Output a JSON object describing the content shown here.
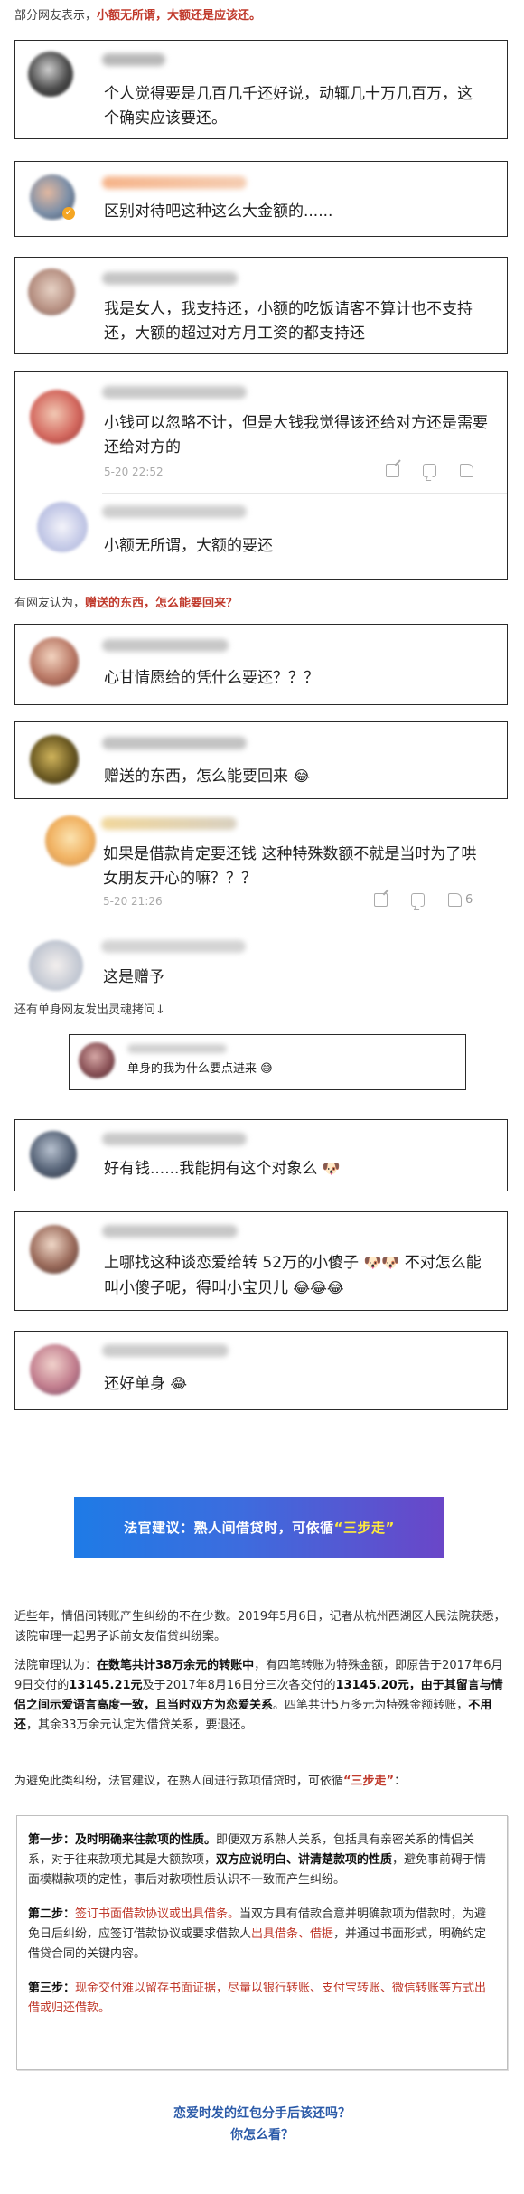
{
  "sections": {
    "s1_prefix": "部分网友表示，",
    "s1_highlight": "小额无所谓，大额还是应该还。",
    "s2_prefix": "有网友认为，",
    "s2_highlight": "赠送的东西，怎么能要回来？",
    "s3_text": "还有单身网友发出灵魂拷问↓"
  },
  "comments": {
    "c1": "个人觉得要是几百几千还好说，动辄几十万几百万，这个确实应该要还。",
    "c2": "区别对待吧这种这么大金额的......",
    "c3": "我是女人，我支持还，小额的吃饭请客不算计也不支持还，大额的超过对方月工资的都支持还",
    "c4": "小钱可以忽略不计，但是大钱我觉得该还给对方还是需要还给对方的",
    "c4_time": "5-20 22:52",
    "c5": "小额无所谓，大额的要还",
    "c6": "心甘情愿给的凭什么要还？？？",
    "c7": "赠送的东西，怎么能要回来",
    "c8": "如果是借款肯定要还钱 这种特殊数额不就是当时为了哄女朋友开心的嘛？？？",
    "c8_time": "5-20 21:26",
    "c8_likes": "6",
    "c9": "这是赠予",
    "c10": "单身的我为什么要点进来",
    "c11": "好有钱......我能拥有这个对象么",
    "c12": "上哪找这种谈恋爱给转 52万的小傻子",
    "c12b": "不对怎么能叫小傻子呢，得叫小宝贝儿",
    "c13": "还好单身"
  },
  "banner": {
    "prefix": "法官建议：熟人间借贷时，可依循",
    "highlight": "“三步走”"
  },
  "article": {
    "p1": "近些年，情侣间转账产生纠纷的不在少数。2019年5月6日，记者从杭州西湖区人民法院获悉，该院审理一起男子诉前女友借贷纠纷案。",
    "p2_a": "法院审理认为：",
    "p2_b": "在数笔共计38万余元的转账中",
    "p2_c": "，有四笔转账为特殊金额，即原告于2017年6月9日交付的",
    "p2_d": "13145.21元",
    "p2_e": "及于2017年8月16日分三次各交付的",
    "p2_f": "13145.20元",
    "p2_g": "，由于其留言与情侣之间示爱语言高度一致，且当时双方为恋爱关系",
    "p2_h": "。四笔共计5万多元为特殊金额转账，",
    "p2_i": "不用还",
    "p2_j": "，其余33万余元认定为借贷关系，要退还。",
    "p3_a": "为避免此类纠纷，法官建议，在熟人间进行款项借贷时，可依循",
    "p3_b": "“三步走”",
    "p3_c": "："
  },
  "steps": {
    "s1_label": "第一步：",
    "s1_title": "及时明确来往款项的性质。",
    "s1_a": "即便双方系熟人关系，包括具有亲密关系的情侣关系，对于往来款项尤其是大额款项，",
    "s1_b": "双方应说明白、讲清楚款项的性质",
    "s1_c": "，避免事前碍于情面模糊款项的定性，事后对款项性质认识不一致而产生纠纷。",
    "s2_label": "第二步：",
    "s2_title": "签订书面借款协议或出具借条。",
    "s2_a": "当双方具有借款合意并明确款项为借款时，为避免日后纠纷，应签订借款协议或要求借款人",
    "s2_b": "出具借条、借据",
    "s2_c": "，并通过书面形式，明确约定借贷合同的关键内容。",
    "s3_label": "第三步：",
    "s3_title": "现金交付难以留存书面证据，尽量以银行转账、支付宝转账、微信转账等方式出借或归还借款。"
  },
  "outro": {
    "line1": "恋爱时发的红包分手后该还吗？",
    "line2": "你怎么看？"
  },
  "colors": {
    "accent_red": "#c0392b",
    "link_blue": "#2b5aa8",
    "banner_start": "#1e7be6",
    "banner_end": "#6a46c8"
  }
}
